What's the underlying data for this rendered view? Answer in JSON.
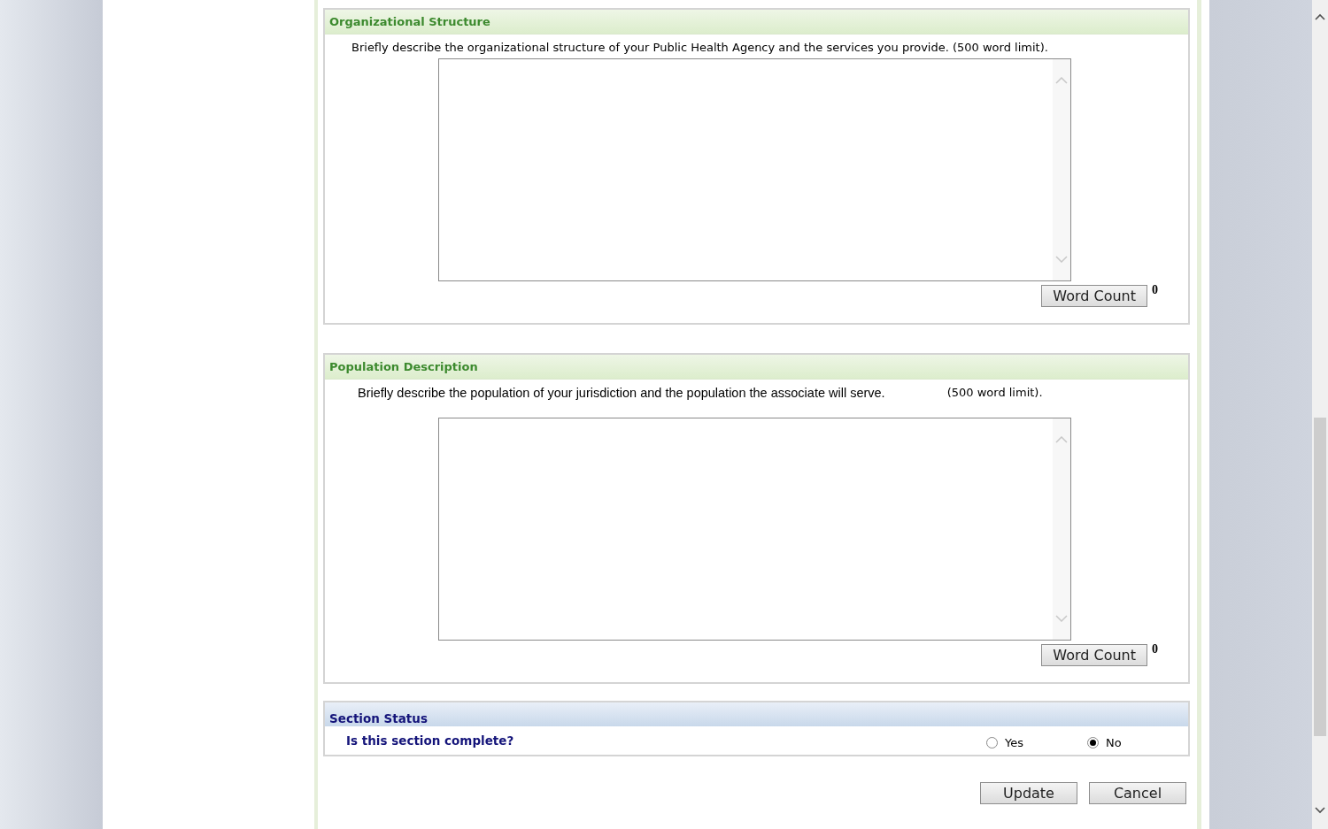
{
  "sections": [
    {
      "title": "Organizational Structure",
      "description": "Briefly describe the organizational structure of your Public Health Agency and the services you provide. (500 word limit).",
      "word_count_button": "Word Count",
      "word_count": "0"
    },
    {
      "title": "Population Description",
      "description": "Briefly describe the population of your jurisdiction and the population  the associate will serve.",
      "limit": "(500 word limit).",
      "word_count_button": "Word Count",
      "word_count": "0"
    }
  ],
  "section_status": {
    "title": "Section Status",
    "question": "Is this section complete?",
    "options": [
      {
        "label": "Yes",
        "selected": false
      },
      {
        "label": "No",
        "selected": true
      }
    ]
  },
  "buttons": [
    {
      "label": "Update"
    },
    {
      "label": "Cancel"
    }
  ]
}
